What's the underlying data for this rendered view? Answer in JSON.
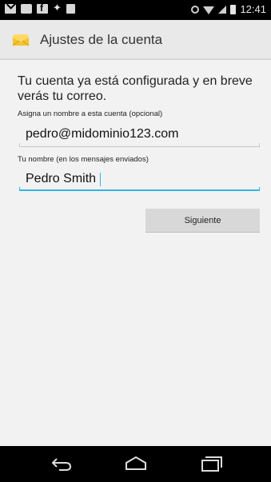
{
  "status_bar": {
    "time": "12:41",
    "icons": [
      "gmail-icon",
      "message-icon",
      "facebook-icon",
      "twitter-icon",
      "document-icon",
      "alarm-icon",
      "wifi-icon",
      "signal-icon",
      "battery-icon"
    ]
  },
  "action_bar": {
    "title": "Ajustes de la cuenta",
    "icon": "email-app-icon"
  },
  "form": {
    "intro": "Tu cuenta ya está configurada y en breve verás tu correo.",
    "account_name_label": "Asigna un nombre a esta cuenta (opcional)",
    "account_name_value": "pedro@midominio123.com",
    "your_name_label": "Tu nombre (en los mensajes enviados)",
    "your_name_value": "Pedro Smith",
    "next_label": "Siguiente"
  },
  "nav_bar": {
    "buttons": [
      "back-icon",
      "home-icon",
      "recent-apps-icon"
    ]
  },
  "colors": {
    "accent": "#33b5e5",
    "background": "#f2f2f2",
    "action_bar": "#e9e9e9",
    "button": "#d8d8d8"
  }
}
